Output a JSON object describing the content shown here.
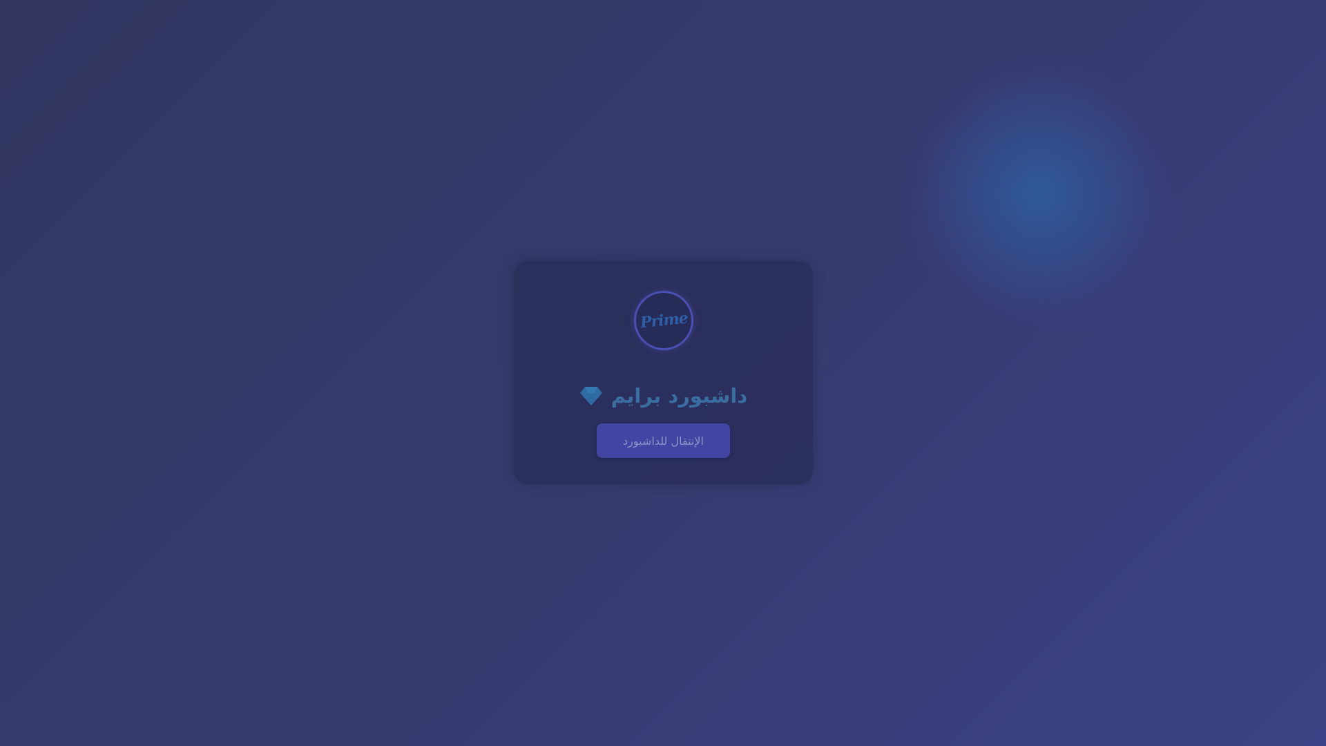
{
  "logo": {
    "text": "Prime",
    "color": "#2f5fa6",
    "ring_color": "#4b4fb1"
  },
  "card": {
    "title": "داشبورد برايم",
    "title_icon": "diamond-icon",
    "title_color": "#3a6ea0",
    "button_label": "الإنتقال للداشبورد",
    "button_color": "#4046a2"
  },
  "colors": {
    "background_start": "#323660",
    "background_end": "#3a4285",
    "glow": "#2c64a5"
  }
}
